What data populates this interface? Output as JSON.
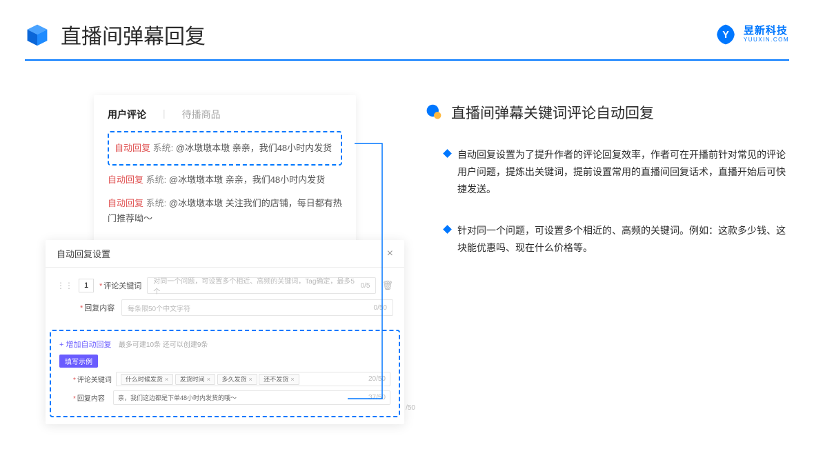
{
  "header": {
    "title": "直播间弹幕回复",
    "brand_cn": "昱新科技",
    "brand_en": "YUUXIN.COM"
  },
  "card1": {
    "tab_active": "用户评论",
    "tab_inactive": "待播商品",
    "rows": [
      {
        "auto": "自动回复",
        "sys": "系统:",
        "text": "@冰墩墩本墩 亲亲，我们48小时内发货"
      },
      {
        "auto": "自动回复",
        "sys": "系统:",
        "text": "@冰墩墩本墩 亲亲，我们48小时内发货"
      },
      {
        "auto": "自动回复",
        "sys": "系统:",
        "text": "@冰墩墩本墩 关注我们的店铺，每日都有热门推荐呦～"
      }
    ]
  },
  "card2": {
    "title": "自动回复设置",
    "order": "1",
    "label_keyword": "评论关键词",
    "placeholder_keyword": "对同一个问题，可设置多个相近、高频的关键词，Tag确定，最多5个",
    "counter_keyword": "0/5",
    "label_content": "回复内容",
    "placeholder_content": "每条限50个中文字符",
    "counter_content": "0/50",
    "add_link": "+ 增加自动回复",
    "add_hint": "最多可建10条 还可以创建9条",
    "badge": "填写示例",
    "ex_label_keyword": "评论关键词",
    "tags": [
      "什么时候发货",
      "发货时间",
      "多久发货",
      "还不发货"
    ],
    "ex_counter_keyword": "20/50",
    "ex_label_content": "回复内容",
    "ex_content": "亲，我们这边都是下单48小时内发货的哦～",
    "ex_counter_content": "37/50",
    "outside_counter": "/50"
  },
  "right": {
    "section_title": "直播间弹幕关键词评论自动回复",
    "bullet1": "自动回复设置为了提升作者的评论回复效率，作者可在开播前针对常见的评论用户问题，提炼出关键词，提前设置常用的直播间回复话术，直播开始后可快捷发送。",
    "bullet2": "针对同一个问题，可设置多个相近的、高频的关键词。例如：这款多少钱、这块能优惠吗、现在什么价格等。"
  }
}
